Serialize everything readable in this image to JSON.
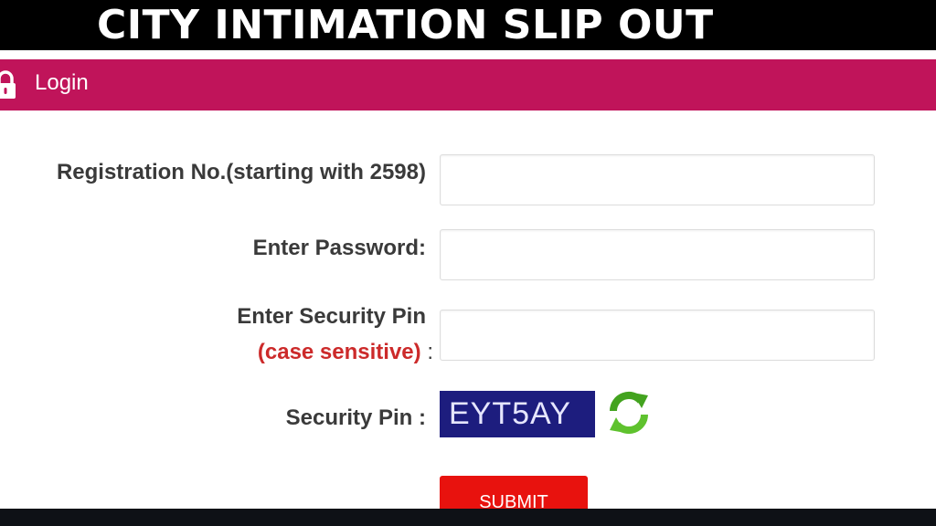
{
  "banner": {
    "title": "CITY INTIMATION SLIP OUT"
  },
  "login_bar": {
    "icon": "lock-icon",
    "label": "Login",
    "color": "#c0145a"
  },
  "form": {
    "registration": {
      "label": "Registration No.(starting with 2598)",
      "value": "",
      "placeholder": ""
    },
    "password": {
      "label": "Enter Password:",
      "value": "",
      "placeholder": ""
    },
    "security_pin_input": {
      "label": "Enter Security Pin",
      "note": "(case sensitive)",
      "colon": ":",
      "value": "",
      "placeholder": ""
    },
    "security_pin": {
      "label": "Security Pin :",
      "captcha": "EYT5AY",
      "refresh_icon": "refresh-icon"
    },
    "submit_label": "SUBMIT"
  },
  "colors": {
    "accent": "#c0145a",
    "submit": "#e8120e",
    "captcha_bg": "#1d1d7e",
    "note": "#cc2a2a"
  }
}
